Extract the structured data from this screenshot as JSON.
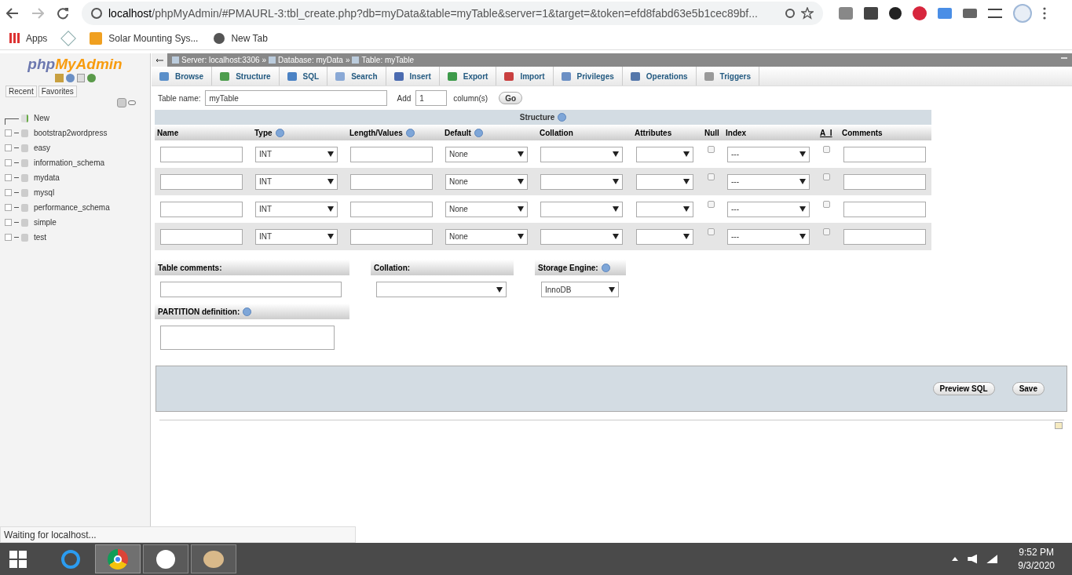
{
  "browser": {
    "url_host": "localhost",
    "url_rest": "/phpMyAdmin/#PMAURL-3:tbl_create.php?db=myData&table=myTable&server=1&target=&token=efd8fabd63e5b1cec89bf...",
    "bookmarks": [
      {
        "kind": "apps",
        "label": "Apps"
      },
      {
        "kind": "network"
      },
      {
        "kind": "solar",
        "label": "Solar Mounting Sys..."
      },
      {
        "kind": "globe",
        "label": "New Tab"
      }
    ]
  },
  "sidebar": {
    "logo_parts": [
      "php",
      "MyAdmin"
    ],
    "tabs": [
      "Recent",
      "Favorites"
    ],
    "tree": [
      {
        "kind": "new",
        "label": "New"
      },
      {
        "kind": "database",
        "label": "bootstrap2wordpress",
        "expanded": false
      },
      {
        "kind": "database",
        "label": "easy",
        "expanded": false
      },
      {
        "kind": "database",
        "label": "information_schema",
        "expanded": false
      },
      {
        "kind": "database",
        "label": "mydata",
        "expanded": false
      },
      {
        "kind": "database",
        "label": "mysql",
        "expanded": false
      },
      {
        "kind": "database",
        "label": "performance_schema",
        "expanded": false
      },
      {
        "kind": "database",
        "label": "simple",
        "expanded": false
      },
      {
        "kind": "database",
        "label": "test",
        "expanded": false
      }
    ]
  },
  "breadcrumb": [
    {
      "label": "Server: localhost:3306",
      "separator": "»"
    },
    {
      "label": "Database: myData",
      "separator": "»"
    },
    {
      "label": "Table: myTable"
    }
  ],
  "tabs": [
    {
      "label": "Browse",
      "selected": false
    },
    {
      "label": "Structure",
      "selected": false
    },
    {
      "label": "SQL",
      "selected": false
    },
    {
      "label": "Search",
      "selected": false
    },
    {
      "label": "Insert",
      "selected": false
    },
    {
      "label": "Export",
      "selected": false
    },
    {
      "label": "Import",
      "selected": false
    },
    {
      "label": "Privileges",
      "selected": false
    },
    {
      "label": "Operations",
      "selected": false
    },
    {
      "label": "Triggers",
      "selected": false
    }
  ],
  "form": {
    "table_name_label": "Table name:",
    "table_name": "myTable",
    "add_label": "Add",
    "add_count": "1",
    "columns_label": "column(s)",
    "go": "Go"
  },
  "structure": {
    "title": "Structure",
    "columns": [
      {
        "label": "Name",
        "help": false
      },
      {
        "label": "Type",
        "help": true
      },
      {
        "label": "Length/Values",
        "help": true
      },
      {
        "label": "Default",
        "help": true
      },
      {
        "label": "Collation",
        "help": false
      },
      {
        "label": "Attributes",
        "help": false
      },
      {
        "label": "Null",
        "help": false
      },
      {
        "label": "Index",
        "help": false
      },
      {
        "label": "A_I",
        "help": false
      },
      {
        "label": "Comments",
        "help": false
      }
    ],
    "rows": [
      {
        "type": "INT",
        "default": "None",
        "null": false,
        "index": "---",
        "ai": false
      },
      {
        "type": "INT",
        "default": "None",
        "null": false,
        "index": "---",
        "ai": false
      },
      {
        "type": "INT",
        "default": "None",
        "null": false,
        "index": "---",
        "ai": false
      },
      {
        "type": "INT",
        "default": "None",
        "null": false,
        "index": "---",
        "ai": false
      }
    ]
  },
  "options": {
    "comments_label": "Table comments:",
    "collation_label": "Collation:",
    "engine_label": "Storage Engine:",
    "engine": "InnoDB",
    "partition_label": "PARTITION definition:"
  },
  "buttons": [
    "Preview SQL",
    "Save"
  ],
  "status": "Waiting for localhost...",
  "taskbar": {
    "time": "9:52 PM",
    "date": "9/3/2020"
  }
}
